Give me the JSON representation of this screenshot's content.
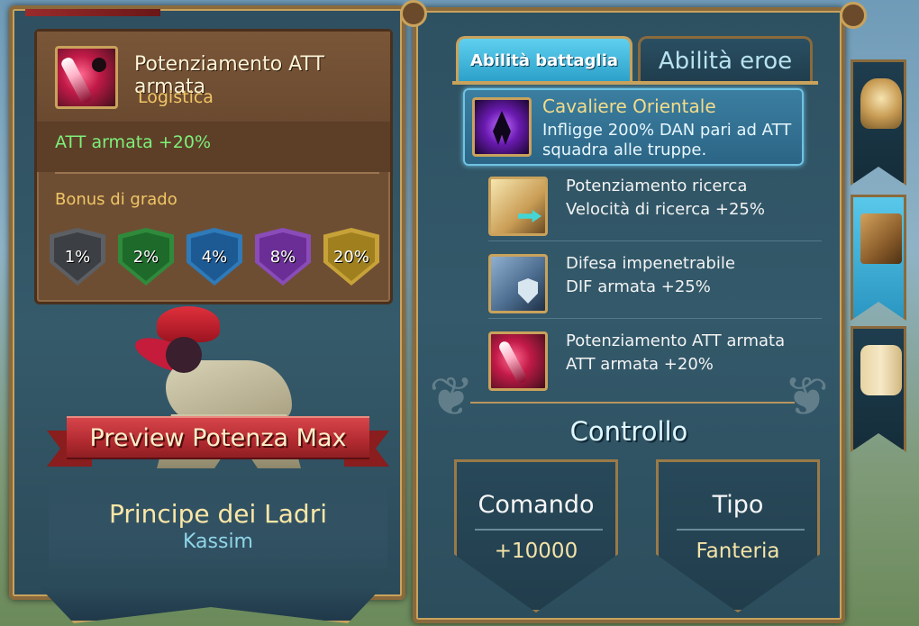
{
  "left": {
    "skill_name": "Potenziamento ATT armata",
    "skill_category": "Logistica",
    "skill_effect": "ATT armata +20%",
    "bonus_label": "Bonus di grado",
    "ranks": [
      {
        "value": "1%",
        "color": "#5c5f63",
        "inner": "#3c3f43"
      },
      {
        "value": "2%",
        "color": "#2f8a3c",
        "inner": "#1d6a2a"
      },
      {
        "value": "4%",
        "color": "#2f7ab8",
        "inner": "#1d5a94"
      },
      {
        "value": "8%",
        "color": "#8a4cb8",
        "inner": "#6a2e96"
      },
      {
        "value": "20%",
        "color": "#c7a238",
        "inner": "#a0801e"
      }
    ],
    "preview_button": "Preview Potenza Max",
    "hero_title": "Principe dei Ladri",
    "hero_name": "Kassim"
  },
  "right": {
    "tabs": [
      "Abilità battaglia",
      "Abilità eroe"
    ],
    "featured": {
      "title": "Cavaliere Orientale",
      "desc": "Infligge 200% DAN pari ad ATT squadra alle truppe."
    },
    "skills": [
      {
        "name": "Potenziamento ricerca",
        "effect": "Velocità di ricerca +25%",
        "icon": "book-icon"
      },
      {
        "name": "Difesa impenetrabile",
        "effect": "DIF armata +25%",
        "icon": "shield-knight-icon"
      },
      {
        "name": "Potenziamento ATT armata",
        "effect": "ATT armata +20%",
        "icon": "blade-icon"
      }
    ],
    "control_title": "Controllo",
    "stats": [
      {
        "label": "Comando",
        "value": "+10000"
      },
      {
        "label": "Tipo",
        "value": "Fanteria"
      }
    ]
  },
  "side_tabs": [
    "helmet-icon",
    "book-icon",
    "scroll-icon"
  ],
  "colors": {
    "effect_green": "#7ef07a",
    "gold_text": "#f0c665",
    "banner_red": "#b12a30",
    "tab_active": "#2a9fc8"
  }
}
